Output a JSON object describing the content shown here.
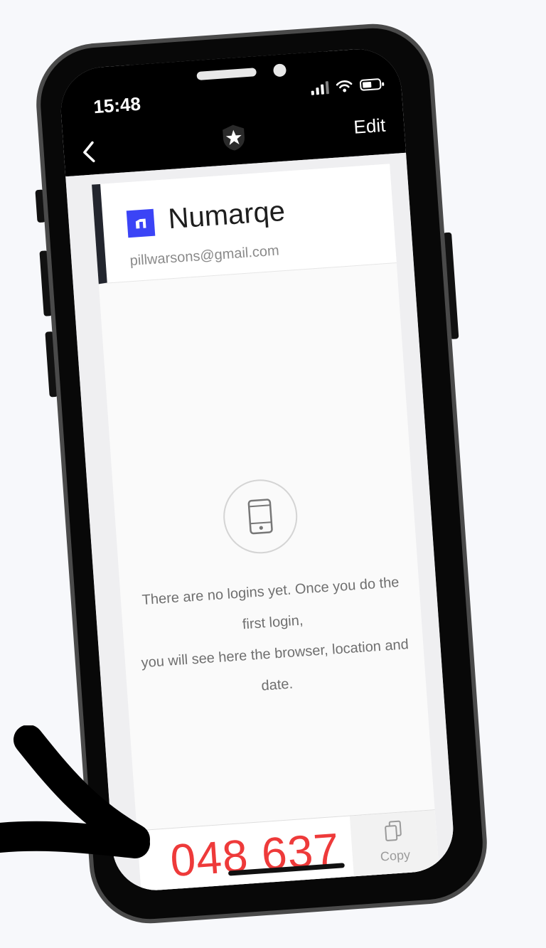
{
  "status_bar": {
    "time": "15:48"
  },
  "nav": {
    "edit_label": "Edit"
  },
  "account": {
    "name": "Numarqe",
    "email": "pillwarsons@gmail.com"
  },
  "empty_state": {
    "message_line1": "There are no logins yet. Once you do the first login,",
    "message_line2": "you will see here the browser, location and date."
  },
  "otp": {
    "code": "048 637",
    "copy_label": "Copy"
  },
  "colors": {
    "accent_code": "#ee3a3a",
    "logo": "#3b44f6",
    "header_stripe": "#23262e"
  }
}
